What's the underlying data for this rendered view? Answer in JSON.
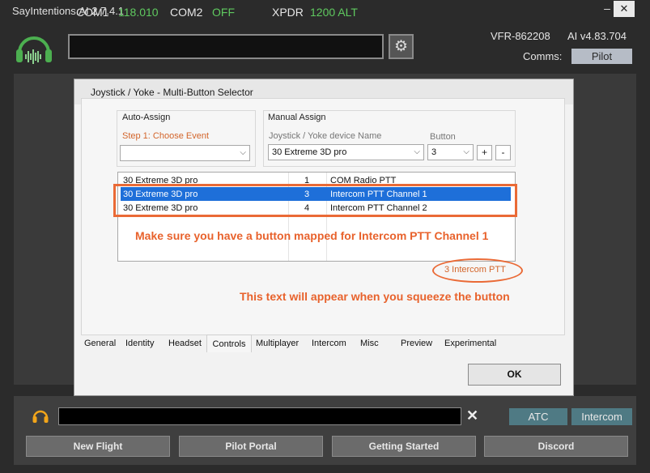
{
  "app": {
    "title": "SayIntentions.AI  2.7.4.1",
    "minimize": "–",
    "close": "✕"
  },
  "header": {
    "com1_label": "COM1",
    "com1_value": "118.010",
    "com2_label": "COM2",
    "com2_value": "OFF",
    "xpdr_label": "XPDR",
    "xpdr_value": "1200 ALT",
    "settings_icon": "gear-icon",
    "callsign": "VFR-862208",
    "version": "AI v4.83.704",
    "comms_label": "Comms:",
    "comms_value": "Pilot",
    "colors": {
      "active_freq": "#5fc95f",
      "logo_green": "#4caf50"
    }
  },
  "dialog": {
    "title": "Joystick / Yoke - Multi-Button Selector",
    "auto_assign": {
      "heading": "Auto-Assign",
      "step_label": "Step 1: Choose Event",
      "event_value": ""
    },
    "manual_assign": {
      "heading": "Manual Assign",
      "device_label": "Joystick / Yoke device Name",
      "device_value": "30  Extreme 3D pro",
      "button_label": "Button",
      "button_value": "3",
      "add": "+",
      "remove": "-"
    },
    "mappings": [
      {
        "device": "30  Extreme 3D pro",
        "button": "1",
        "action": "COM Radio PTT",
        "selected": false
      },
      {
        "device": "30  Extreme 3D pro",
        "button": "3",
        "action": "Intercom PTT Channel 1",
        "selected": true
      },
      {
        "device": "30  Extreme 3D pro",
        "button": "4",
        "action": "Intercom PTT Channel 2",
        "selected": false
      }
    ],
    "status_text": "3  Intercom PTT",
    "annotation_1": "Make sure you have a button mapped for Intercom PTT Channel 1",
    "annotation_2": "This text will appear when you squeeze the button",
    "tabs": [
      "General",
      "Identity",
      "Headset",
      "Controls",
      "Multiplayer",
      "Intercom",
      "Misc",
      "Preview",
      "Experimental"
    ],
    "active_tab": "Controls",
    "ok_label": "OK",
    "colors": {
      "annotation": "#e8622c",
      "selection": "#1e6fd9"
    }
  },
  "footer": {
    "message_value": "",
    "clear_label": "✕",
    "atc_label": "ATC",
    "intercom_label": "Intercom",
    "buttons": [
      "New Flight",
      "Pilot Portal",
      "Getting Started",
      "Discord"
    ]
  }
}
